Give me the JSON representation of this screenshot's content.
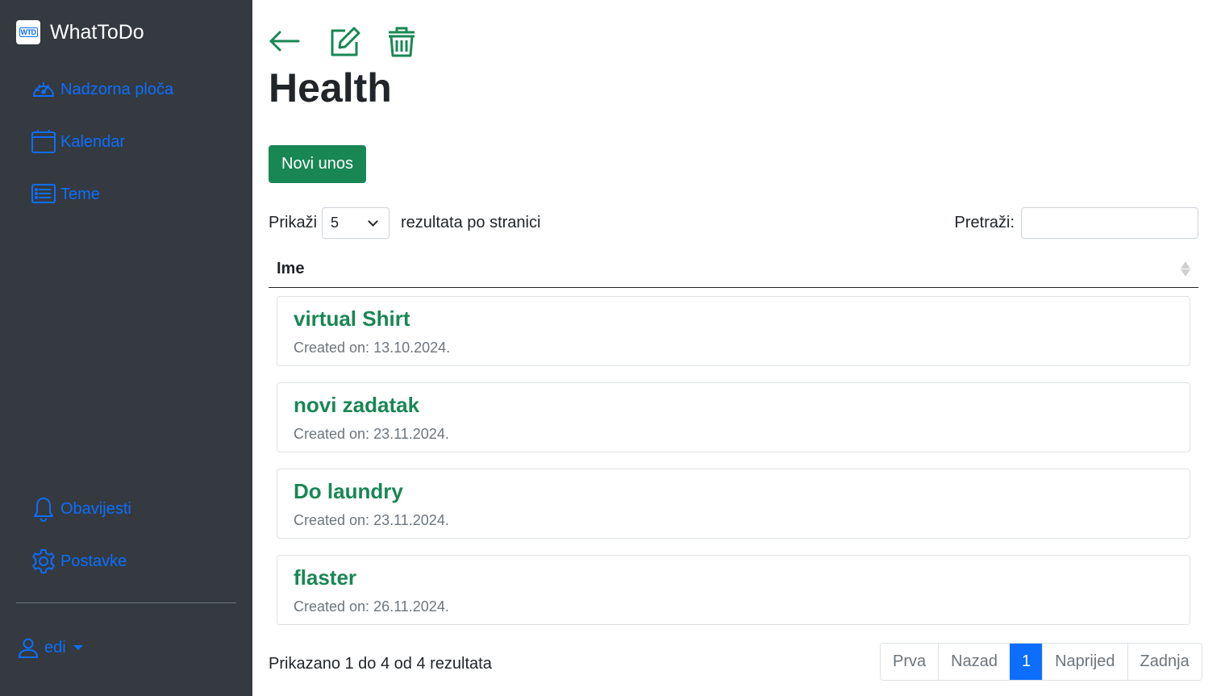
{
  "app": {
    "title": "WhatToDo",
    "logo_text": "WTD"
  },
  "sidebar": {
    "items": [
      {
        "label": "Nadzorna ploča",
        "icon": "speedometer-icon"
      },
      {
        "label": "Kalendar",
        "icon": "calendar-icon"
      },
      {
        "label": "Teme",
        "icon": "list-icon"
      }
    ],
    "bottom_items": [
      {
        "label": "Obavijesti",
        "icon": "bell-icon"
      },
      {
        "label": "Postavke",
        "icon": "gear-icon"
      }
    ],
    "user": {
      "name": "edi",
      "icon": "person-icon"
    }
  },
  "toolbar": {
    "back_icon": "arrow-left-icon",
    "edit_icon": "edit-icon",
    "delete_icon": "trash-icon"
  },
  "page": {
    "title": "Health",
    "new_button": "Novi unos"
  },
  "table": {
    "length_prefix": "Prikaži",
    "length_value": "5",
    "length_suffix": "rezultata po stranici",
    "search_label": "Pretraži:",
    "search_value": "",
    "column_header": "Ime",
    "rows": [
      {
        "title": "virtual Shirt",
        "date_label": "Created on:",
        "date": "13.10.2024."
      },
      {
        "title": "novi zadatak",
        "date_label": "Created on:",
        "date": "23.11.2024."
      },
      {
        "title": "Do laundry",
        "date_label": "Created on:",
        "date": "23.11.2024."
      },
      {
        "title": "flaster",
        "date_label": "Created on:",
        "date": "26.11.2024."
      }
    ],
    "info": "Prikazano 1 do 4 od 4 rezultata",
    "pagination": {
      "first": "Prva",
      "prev": "Nazad",
      "current": "1",
      "next": "Naprijed",
      "last": "Zadnja"
    }
  },
  "colors": {
    "sidebar_bg": "#343a40",
    "link": "#0d6efd",
    "accent": "#198754",
    "muted": "#6c757d"
  }
}
